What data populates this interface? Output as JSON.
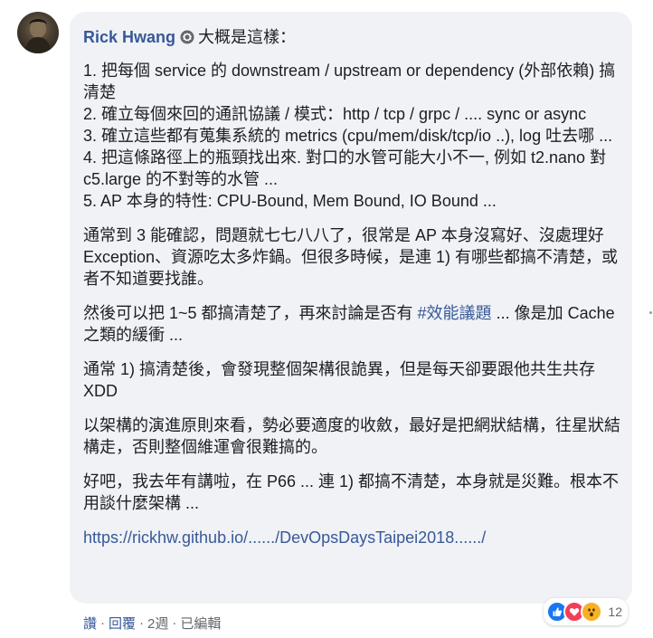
{
  "comment": {
    "author": "Rick Hwang",
    "intro": "大概是這樣：",
    "list": [
      "1. 把每個 service 的 downstream / upstream or dependency (外部依賴) 搞清楚",
      "2. 確立每個來回的通訊協議 / 模式：http / tcp / grpc / .... sync or async",
      "3. 確立這些都有蒐集系統的 metrics (cpu/mem/disk/tcp/io ..), log 吐去哪 ...",
      "4. 把這條路徑上的瓶頸找出來. 對口的水管可能大小不一, 例如 t2.nano 對 c5.large 的不對等的水管 ...",
      "5. AP 本身的特性: CPU-Bound, Mem Bound, IO Bound ..."
    ],
    "para1": "通常到 3 能確認，問題就七七八八了，很常是 AP 本身沒寫好、沒處理好 Exception、資源吃太多炸鍋。但很多時候，是連 1) 有哪些都搞不清楚，或者不知道要找誰。",
    "para2_before": "然後可以把 1~5 都搞清楚了，再來討論是否有 ",
    "para2_hashtag": "#效能議題",
    "para2_after": " ... 像是加 Cache 之類的緩衝 ...",
    "para3": "通常 1) 搞清楚後，會發現整個架構很詭異，但是每天卻要跟他共生共存 XDD",
    "para4": "以架構的演進原則來看，勢必要適度的收斂，最好是把網狀結構，往星狀結構走，否則整個維運會很難搞的。",
    "para5": "好吧，我去年有講啦，在 P66 ... 連 1) 都搞不清楚，本身就是災難。根本不用談什麼架構 ...",
    "link": "https://rickhw.github.io/....../DevOpsDaysTaipei2018....../"
  },
  "reactions": {
    "icons": [
      "like-icon",
      "love-icon",
      "wow-icon"
    ],
    "count": "12"
  },
  "actions": {
    "like": "讚",
    "reply": "回覆",
    "time": "2週",
    "edited": "已編輯",
    "separator": "·"
  },
  "colors": {
    "link": "#385898",
    "bubble": "#f0f2f5",
    "text": "#1c1e21",
    "like": "#1877f2",
    "love": "#f33e58",
    "wow": "#f7b125"
  }
}
